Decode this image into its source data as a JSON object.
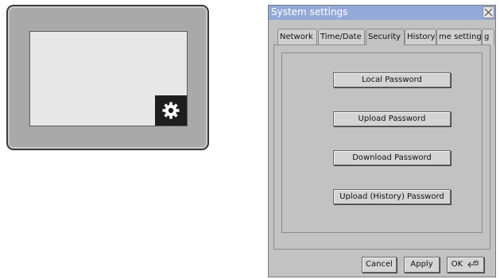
{
  "device": {
    "settings_icon": "gear-icon",
    "colors": {
      "bezel": "#a9a9a9",
      "screen": "#e7e7e7",
      "gear_tile": "#1e1e1e"
    }
  },
  "window": {
    "title": "System settings",
    "close_icon": "close-icon",
    "title_bar_color": "#93a9d9",
    "background_color": "#c2c2c2"
  },
  "tabs": [
    {
      "label": "Network",
      "active": false
    },
    {
      "label": "Time/Date",
      "active": false
    },
    {
      "label": "Security",
      "active": true
    },
    {
      "label": "History",
      "active": false
    },
    {
      "label": "me setting",
      "active": false
    },
    {
      "label": "g",
      "active": false
    }
  ],
  "security": {
    "buttons": [
      "Local Password",
      "Upload Password",
      "Download Password",
      "Upload (History) Password"
    ]
  },
  "footer": {
    "cancel_label": "Cancel",
    "apply_label": "Apply",
    "ok_label": "OK",
    "ok_icon": "enter-key-icon"
  }
}
